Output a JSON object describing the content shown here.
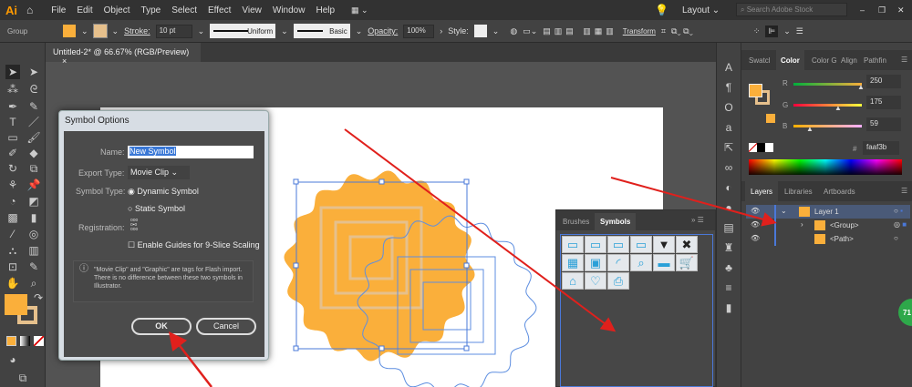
{
  "app": {
    "logo": "Ai",
    "menu": [
      "File",
      "Edit",
      "Object",
      "Type",
      "Select",
      "Effect",
      "View",
      "Window",
      "Help"
    ],
    "workspace": "Layout",
    "search_placeholder": "Search Adobe Stock"
  },
  "control": {
    "selection": "Group",
    "stroke_label": "Stroke:",
    "stroke_value": "10 pt",
    "profile": "Uniform",
    "brush": "Basic",
    "opacity_label": "Opacity:",
    "opacity_value": "100%",
    "style_label": "Style:",
    "transform": "Transform",
    "fill_color": "#faaf3b"
  },
  "document": {
    "tab": "Untitled-2* @ 66.67% (RGB/Preview)",
    "close": "×"
  },
  "dialog": {
    "title": "Symbol Options",
    "name_label": "Name:",
    "name_value": "New Symbol",
    "export_label": "Export Type:",
    "export_value": "Movie Clip",
    "symtype_label": "Symbol Type:",
    "dynamic": "Dynamic Symbol",
    "static": "Static Symbol",
    "registration_label": "Registration:",
    "guides": "Enable Guides for 9-Slice Scaling",
    "info": "\"Movie Clip\" and \"Graphic\" are tags for Flash import. There is no difference between these two symbols in Illustrator.",
    "ok": "OK",
    "cancel": "Cancel"
  },
  "color_panel": {
    "tabs": [
      "Swatcl",
      "Color",
      "Color G",
      "Align",
      "Pathfin"
    ],
    "r_label": "R",
    "g_label": "G",
    "b_label": "B",
    "r": "250",
    "g": "175",
    "b": "59",
    "hex_label": "#",
    "hex": "faaf3b"
  },
  "layers_panel": {
    "tabs": [
      "Layers",
      "Libraries",
      "Artboards"
    ],
    "rows": [
      "Layer 1",
      "<Group>",
      "<Path>"
    ]
  },
  "symbols_panel": {
    "tabs": [
      "Brushes",
      "Symbols"
    ]
  },
  "badge": "71"
}
